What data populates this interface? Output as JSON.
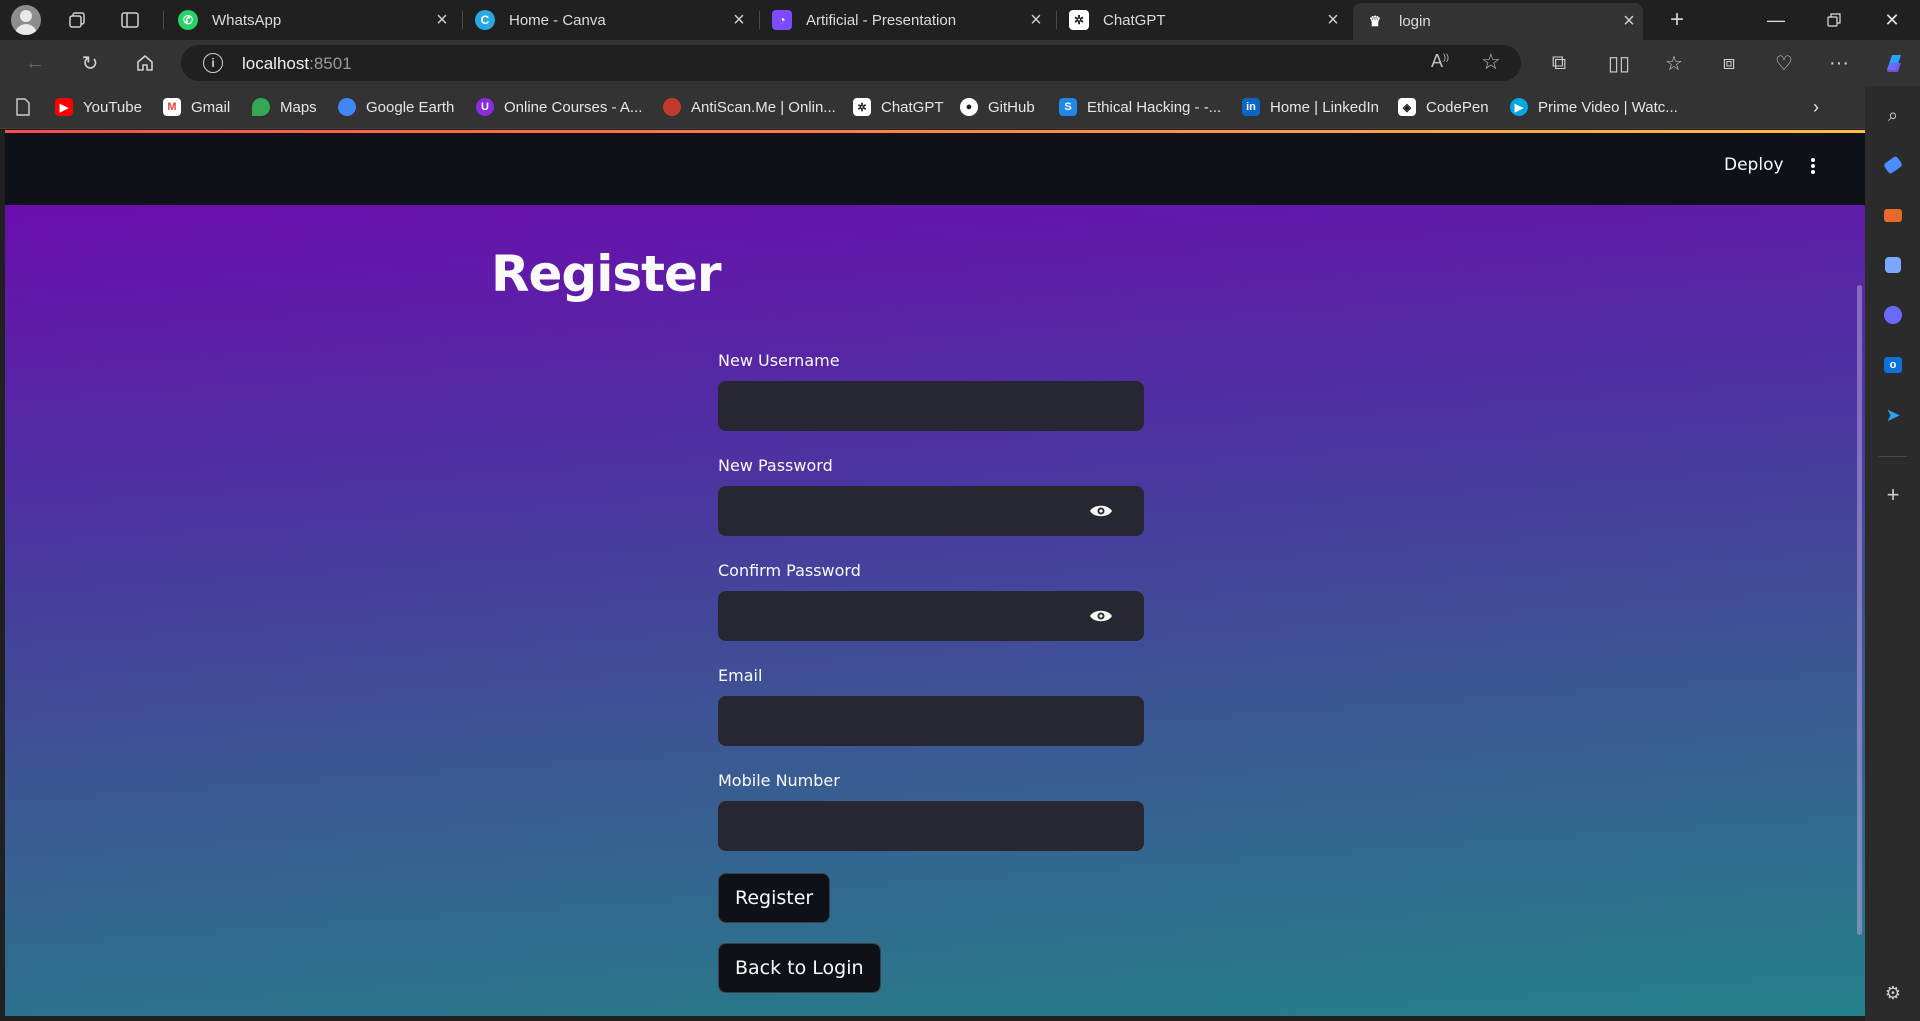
{
  "browser": {
    "tabs": [
      {
        "title": "WhatsApp",
        "icon": "whatsapp-icon",
        "color": "#25d366"
      },
      {
        "title": "Home - Canva",
        "icon": "canva-icon",
        "color": "#00c4cc"
      },
      {
        "title": "Artificial - Presentation",
        "icon": "presentation-icon",
        "color": "#7b4bff"
      },
      {
        "title": "ChatGPT",
        "icon": "chatgpt-icon",
        "color": "#ffffff"
      },
      {
        "title": "login",
        "icon": "streamlit-crown-icon",
        "color": "#ffffff"
      }
    ],
    "address": {
      "host": "localhost",
      "port": ":8501"
    },
    "bookmarks": [
      {
        "label": "YouTube",
        "icon": "youtube-icon",
        "color": "#ff0000"
      },
      {
        "label": "Gmail",
        "icon": "gmail-icon",
        "color": "#ea4335"
      },
      {
        "label": "Maps",
        "icon": "maps-icon",
        "color": "#34a853"
      },
      {
        "label": "Google Earth",
        "icon": "earth-icon",
        "color": "#4285f4"
      },
      {
        "label": "Online Courses - A...",
        "icon": "courses-icon",
        "color": "#8a2be2"
      },
      {
        "label": "AntiScan.Me | Onlin...",
        "icon": "antiscan-icon",
        "color": "#c0392b"
      },
      {
        "label": "ChatGPT",
        "icon": "chatgpt-icon",
        "color": "#ffffff"
      },
      {
        "label": "GitHub",
        "icon": "github-icon",
        "color": "#ffffff"
      },
      {
        "label": "Ethical Hacking - -...",
        "icon": "ethical-hacking-icon",
        "color": "#1e88e5"
      },
      {
        "label": "Home | LinkedIn",
        "icon": "linkedin-icon",
        "color": "#0a66c2"
      },
      {
        "label": "CodePen",
        "icon": "codepen-icon",
        "color": "#ffffff"
      },
      {
        "label": "Prime Video | Watc...",
        "icon": "prime-video-icon",
        "color": "#00a8e1"
      }
    ]
  },
  "app": {
    "header": {
      "deploy_label": "Deploy"
    },
    "title": "Register",
    "fields": {
      "username": {
        "label": "New Username",
        "value": ""
      },
      "password": {
        "label": "New Password",
        "value": ""
      },
      "confirm": {
        "label": "Confirm Password",
        "value": ""
      },
      "email": {
        "label": "Email",
        "value": ""
      },
      "mobile": {
        "label": "Mobile Number",
        "value": ""
      }
    },
    "buttons": {
      "register": "Register",
      "back": "Back to Login"
    },
    "colors": {
      "gradient_top": "#6a0dad",
      "gradient_bottom": "#24808a",
      "input_bg": "#262730",
      "button_bg": "#0e1117",
      "header_bg": "#0e1117"
    }
  }
}
